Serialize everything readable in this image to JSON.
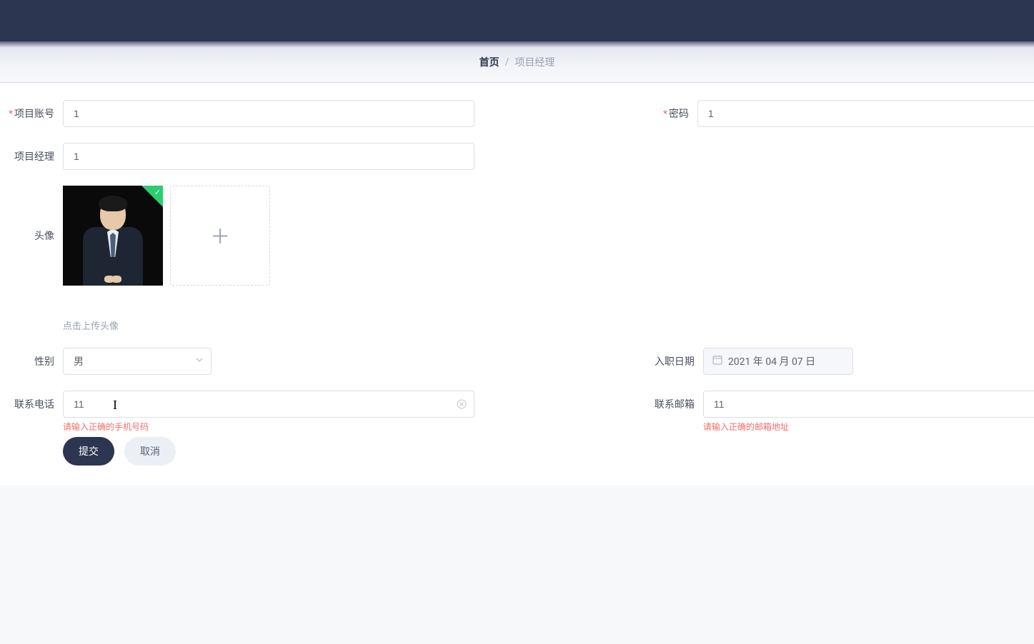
{
  "breadcrumb": {
    "home": "首页",
    "current": "项目经理"
  },
  "labels": {
    "account": "项目账号",
    "password": "密码",
    "manager": "项目经理",
    "avatar": "头像",
    "gender": "性别",
    "hire_date": "入职日期",
    "phone": "联系电话",
    "email": "联系邮箱"
  },
  "values": {
    "account": "1",
    "password": "1",
    "manager": "1",
    "gender": "男",
    "hire_date": "2021 年 04 月 07 日",
    "phone": "11",
    "email": "11"
  },
  "hints": {
    "upload": "点击上传头像"
  },
  "errors": {
    "phone": "请输入正确的手机号码",
    "email": "请输入正确的邮箱地址"
  },
  "buttons": {
    "submit": "提交",
    "cancel": "取消"
  }
}
